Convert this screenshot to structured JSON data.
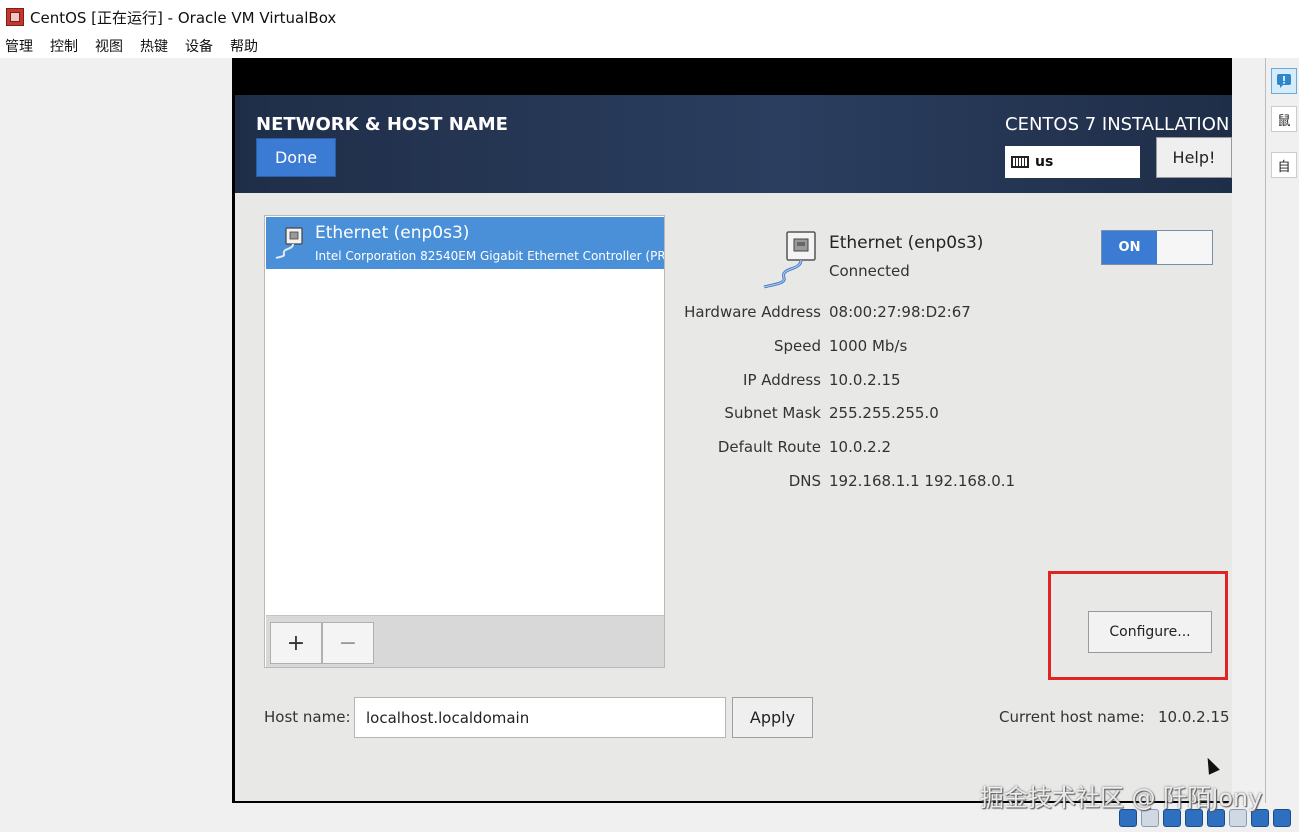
{
  "window": {
    "title": "CentOS [正在运行] - Oracle VM VirtualBox",
    "menu": [
      "管理",
      "控制",
      "视图",
      "热键",
      "设备",
      "帮助"
    ],
    "side_buttons": [
      "鼠",
      "自"
    ]
  },
  "installer": {
    "header_title": "NETWORK & HOST NAME",
    "done_label": "Done",
    "install_title": "CENTOS 7 INSTALLATION",
    "keyboard_layout": "us",
    "help_label": "Help!"
  },
  "device_list": {
    "items": [
      {
        "name": "Ethernet (enp0s3)",
        "description": "Intel Corporation 82540EM Gigabit Ethernet Controller (PR"
      }
    ],
    "add_label": "+",
    "remove_label": "−"
  },
  "details": {
    "name": "Ethernet (enp0s3)",
    "status": "Connected",
    "toggle_label": "ON",
    "properties": [
      {
        "label": "Hardware Address",
        "value": "08:00:27:98:D2:67"
      },
      {
        "label": "Speed",
        "value": "1000 Mb/s"
      },
      {
        "label": "IP Address",
        "value": "10.0.2.15"
      },
      {
        "label": "Subnet Mask",
        "value": "255.255.255.0"
      },
      {
        "label": "Default Route",
        "value": "10.0.2.2"
      },
      {
        "label": "DNS",
        "value": "192.168.1.1 192.168.0.1"
      }
    ],
    "configure_label": "Configure..."
  },
  "hostname": {
    "label": "Host name:",
    "value": "localhost.localdomain",
    "apply_label": "Apply",
    "current_label": "Current host name:",
    "current_value": "10.0.2.15"
  },
  "watermark": "掘金技术社区 @ 阡陌Jony",
  "colors": {
    "accent": "#3b7bd4",
    "selection": "#4a90d9",
    "header": "#2b3e5f",
    "highlight": "#e02424"
  }
}
